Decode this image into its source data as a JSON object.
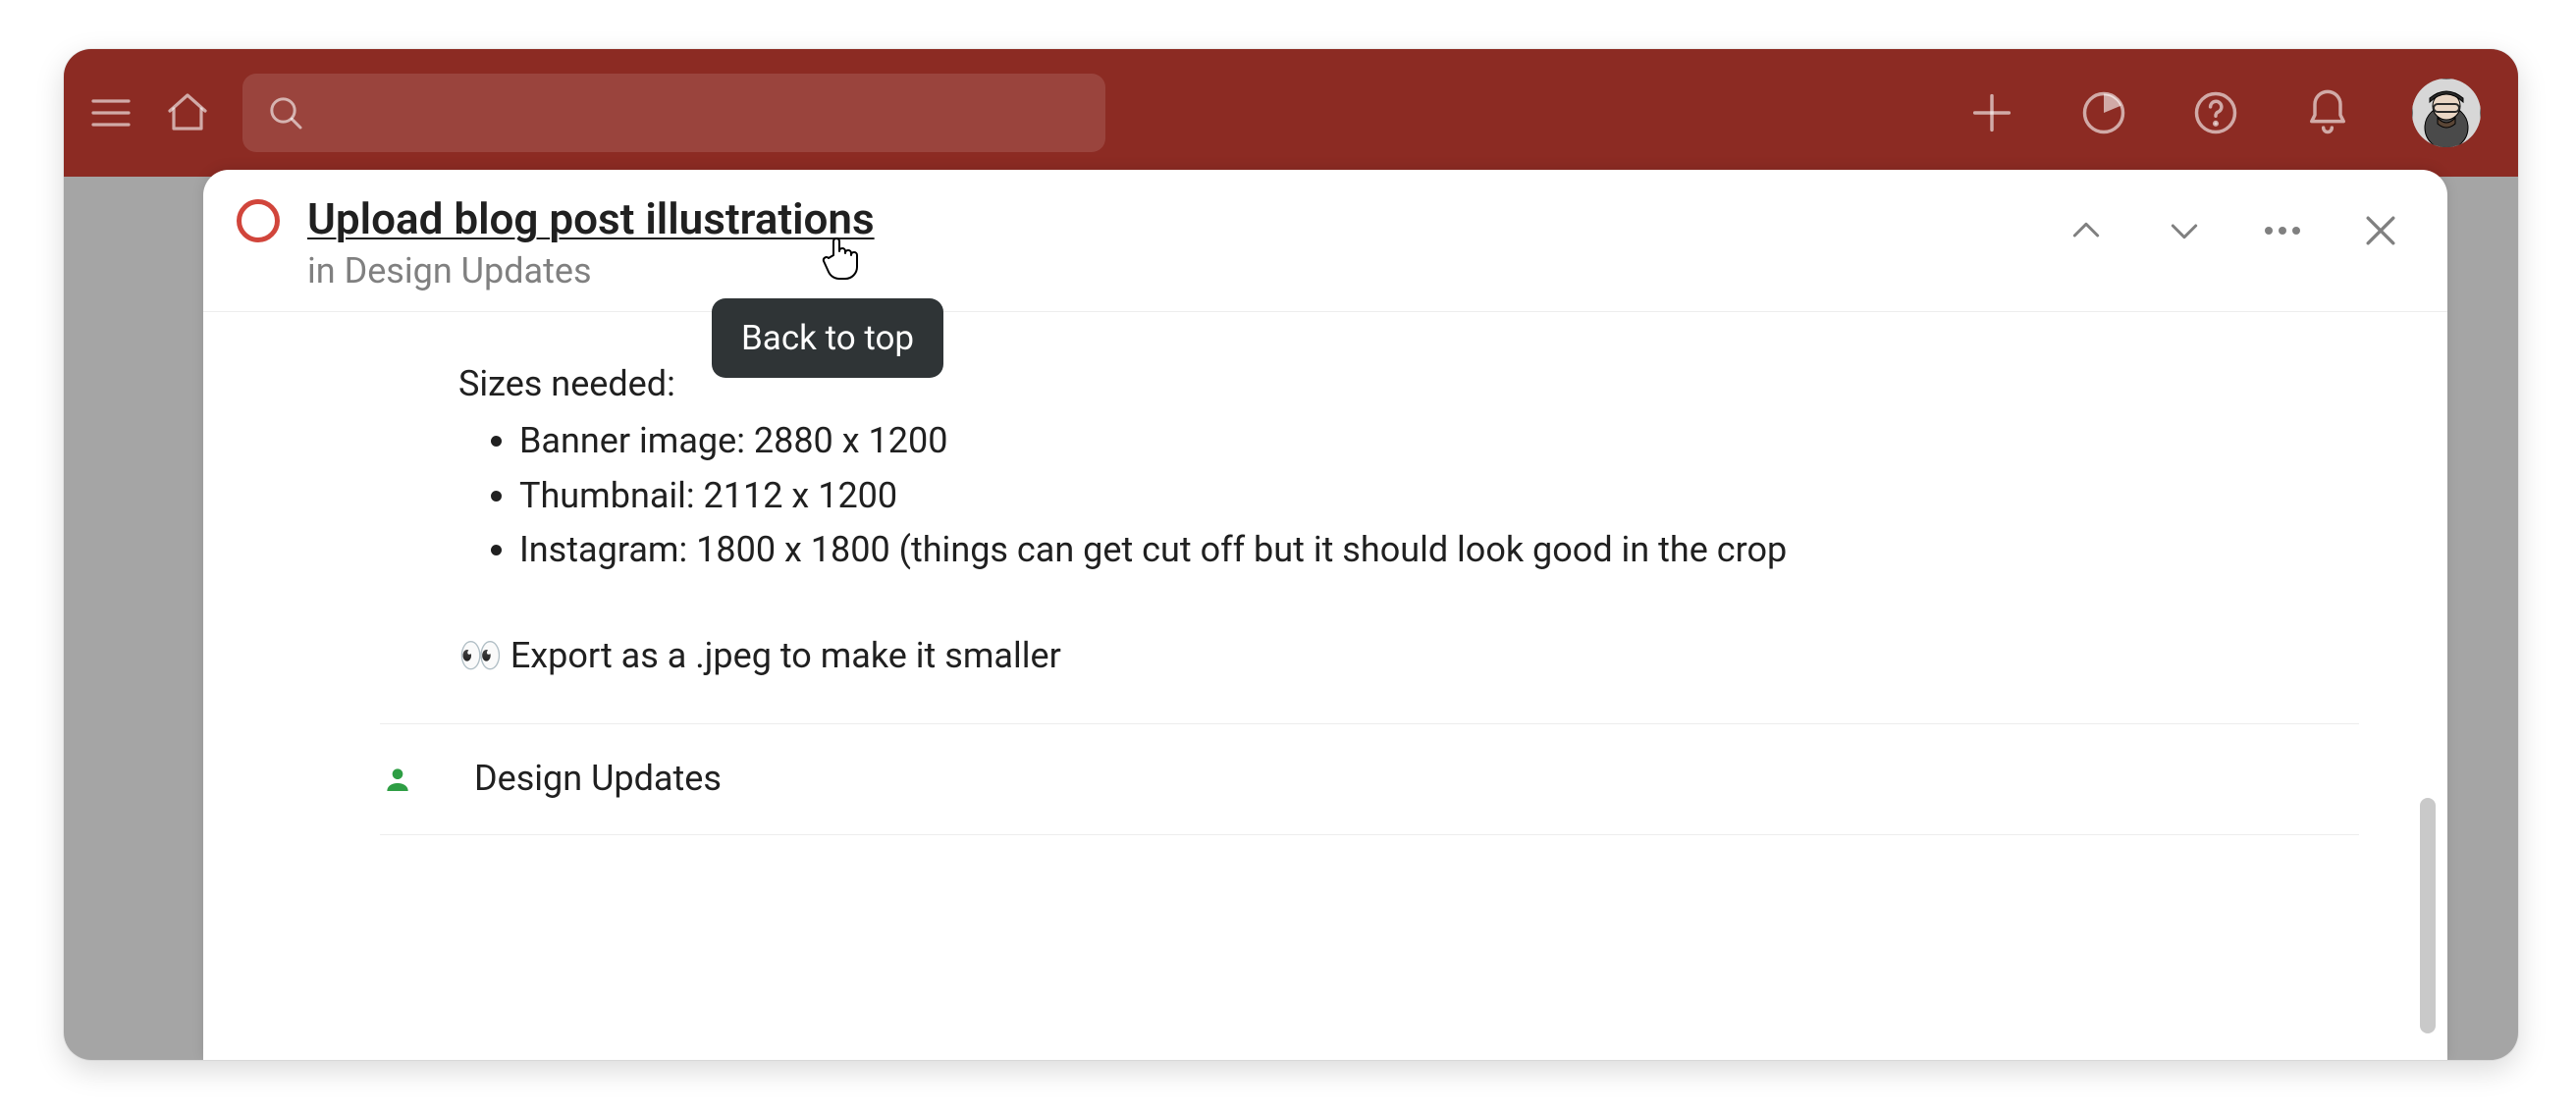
{
  "colors": {
    "topbar_bg": "#8c2b23",
    "accent_red": "#d1453b",
    "assignee_green": "#2e9e44",
    "tooltip_bg": "#2f3436",
    "text_primary": "#202020",
    "text_muted": "#808080"
  },
  "topbar": {
    "search_placeholder": ""
  },
  "task": {
    "title": "Upload blog post illustrations",
    "context_prefix": "in ",
    "context_project": "Design Updates"
  },
  "tooltip": {
    "text": "Back to top"
  },
  "description": {
    "heading": "Sizes needed:",
    "items": [
      "Banner image: 2880 x 1200",
      "Thumbnail: 2112 x 1200",
      "Instagram: 1800 x 1800 (things can get cut off but it should look good in the crop"
    ],
    "note_emoji": "👀",
    "note_text": "Export as a .jpeg to make it smaller"
  },
  "assignee": {
    "label": "Design Updates"
  }
}
